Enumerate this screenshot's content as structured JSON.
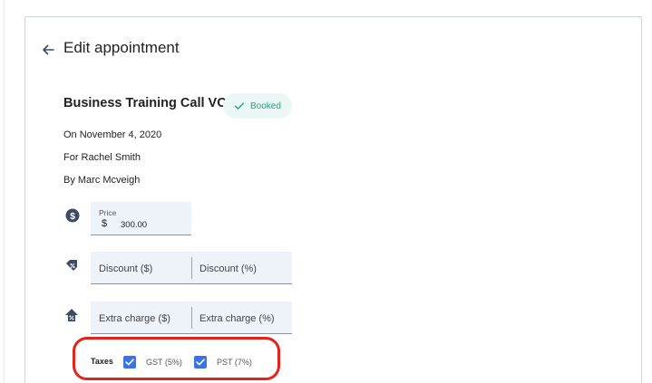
{
  "header": {
    "title": "Edit appointment"
  },
  "appointment": {
    "title": "Business Training Call VC",
    "status": "Booked",
    "date_line": "On November 4, 2020",
    "client_line": "For Rachel Smith",
    "staff_line": "By Marc Mcveigh"
  },
  "price": {
    "label": "Price",
    "currency": "$",
    "value": "300.00"
  },
  "discount": {
    "amount_placeholder": "Discount ($)",
    "percent_placeholder": "Discount (%)"
  },
  "extra_charge": {
    "amount_placeholder": "Extra charge ($)",
    "percent_placeholder": "Extra charge (%)"
  },
  "taxes": {
    "title": "Taxes",
    "items": [
      {
        "label": "GST (5%)",
        "checked": true
      },
      {
        "label": "PST (7%)",
        "checked": true
      }
    ]
  },
  "colors": {
    "accent": "#3a72e8",
    "status_green": "#20a483",
    "highlight_red": "#e5231b",
    "icon_dark": "#3d4a63"
  },
  "icons": {
    "back": "arrow-left-icon",
    "status": "check-icon",
    "price": "dollar-circle-icon",
    "discount": "discount-tag-icon",
    "extra_charge": "extra-charge-icon"
  }
}
